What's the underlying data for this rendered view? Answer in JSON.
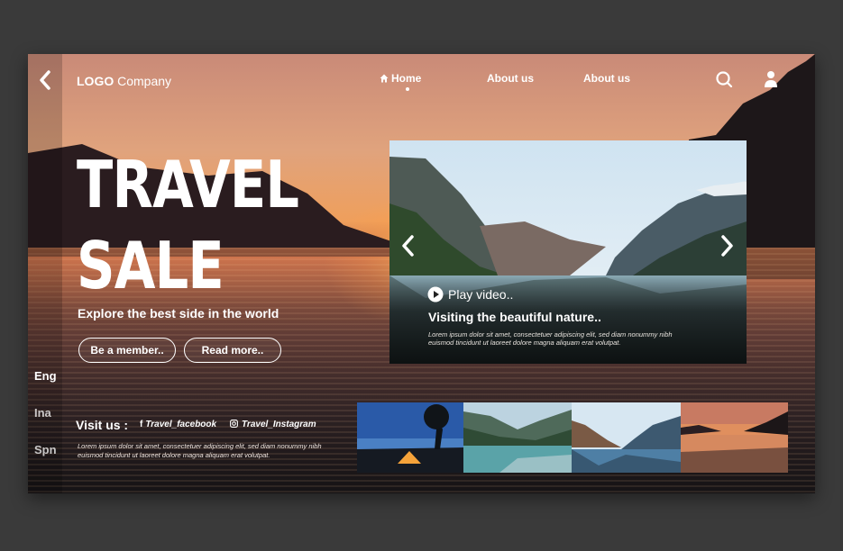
{
  "header": {
    "logo_bold": "LOGO",
    "logo_rest": " Company",
    "nav": {
      "home": "Home",
      "about1": "About us",
      "about2": "About us"
    }
  },
  "hero": {
    "title_line1": "TRAVEL",
    "title_line2": "SALE",
    "subtitle": "Explore the best side in the world",
    "btn_member": "Be a member..",
    "btn_read": "Read more.."
  },
  "languages": [
    "Eng",
    "Ina",
    "Spn"
  ],
  "video_card": {
    "play_label": "Play video..",
    "title": "Visiting the beautiful nature..",
    "body": "Lorem ipsum dolor sit amet, consectetuer adipiscing elit, sed diam nonummy nibh euismod tincidunt ut laoreet dolore magna aliquam erat volutpat."
  },
  "footer": {
    "visit_label": "Visit us :",
    "facebook": "Travel_facebook",
    "instagram": "Travel_Instagram",
    "lorem": "Lorem ipsum dolor sit amet, consectetuer adipiscing elit, sed diam nonummy nibh euismod tincidunt ut laoreet dolore magna aliquam erat volutpat."
  },
  "icons": {
    "back": "chevron-left-icon",
    "home": "home-icon",
    "search": "search-icon",
    "user": "user-icon",
    "play": "play-icon",
    "facebook": "facebook-icon",
    "instagram": "instagram-icon"
  },
  "colors": {
    "background": "#3a3a3a",
    "text": "#ffffff"
  }
}
